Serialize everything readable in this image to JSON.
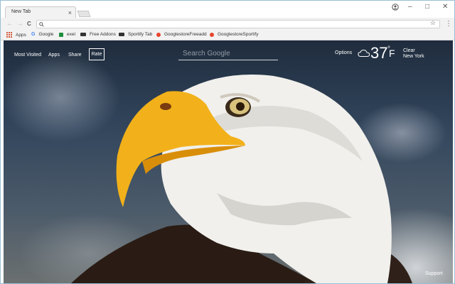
{
  "tab": {
    "title": "New Tab",
    "close": "×"
  },
  "window_controls": {
    "minimize": "–",
    "maximize": "□",
    "close": "✕"
  },
  "toolbar": {
    "back": "←",
    "forward": "→",
    "reload": "C",
    "address": "",
    "star": "☆",
    "menu": "⋮"
  },
  "bookmarks": [
    {
      "label": "Apps",
      "icon": "apps-grid-icon"
    },
    {
      "label": "Google",
      "icon": "google-icon",
      "color": "#4285f4"
    },
    {
      "label": "exel",
      "icon": "sheet-icon",
      "color": "#1e8e3e"
    },
    {
      "label": "Free Addons",
      "icon": "addon-icon",
      "color": "#333333"
    },
    {
      "label": "Sportify Tab",
      "icon": "addon-icon",
      "color": "#333333"
    },
    {
      "label": "GooglestoreFreeadd",
      "icon": "store-icon",
      "color": "#e8452c"
    },
    {
      "label": "GooglestoreSportify",
      "icon": "store-icon",
      "color": "#e8452c"
    }
  ],
  "newtab_page": {
    "nav": {
      "most_visited": "Most Visited",
      "apps": "Apps",
      "share": "Share",
      "rate": "Rate"
    },
    "search": {
      "placeholder": "Search Google"
    },
    "options": "Options",
    "weather": {
      "temp": "37",
      "degree": "°",
      "unit": "F",
      "condition": "Clear",
      "location": "New York",
      "icon": "cloud-icon"
    },
    "support": "Support"
  }
}
